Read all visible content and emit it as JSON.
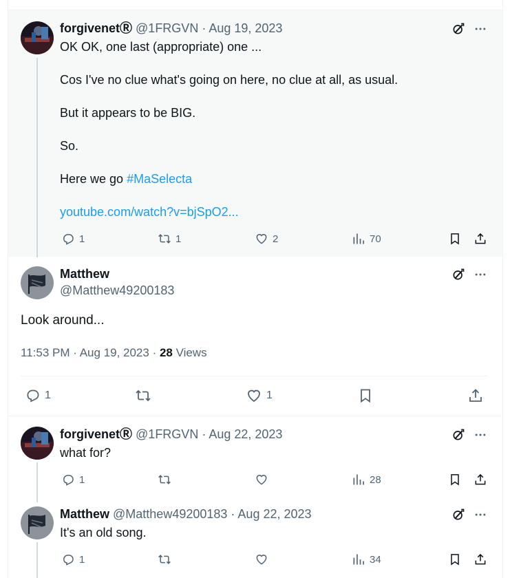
{
  "tweet1": {
    "name": "forgivenet",
    "badge": "Ⓡ",
    "handle": "@1FRGVN",
    "date": "Aug 19, 2023",
    "lines": [
      "OK OK, one last (appropriate) one ...",
      "Cos I've no clue what's going on here, no clue at all, as usual.",
      "But it appears to be BIG.",
      "So.",
      "Here we go "
    ],
    "hashtag": "#MaSelecta",
    "link": "youtube.com/watch?v=bjSpO2...",
    "replies": "1",
    "reposts": "1",
    "likes": "2",
    "views": "70"
  },
  "main": {
    "name": "Matthew",
    "handle": "@Matthew49200183",
    "text": "Look around...",
    "time": "11:53 PM",
    "date": "Aug 19, 2023",
    "views_count": "28",
    "views_label": "Views",
    "replies": "1",
    "likes": "1"
  },
  "reply1": {
    "name": "forgivenet",
    "badge": "Ⓡ",
    "handle": "@1FRGVN",
    "date": "Aug 22, 2023",
    "text": "what for?",
    "replies": "1",
    "views": "28"
  },
  "reply2": {
    "name": "Matthew",
    "handle": "@Matthew49200183",
    "date": "Aug 22, 2023",
    "text": "It's an old song.",
    "replies": "1",
    "views": "34"
  },
  "sep": " · ",
  "icons": [
    "grok-icon",
    "more-icon",
    "reply-icon",
    "repost-icon",
    "like-icon",
    "views-icon",
    "bookmark-icon",
    "share-icon"
  ],
  "colors": {
    "accent": "#1d9bf0",
    "secondary": "#536471",
    "highlight_bg": "#f7f9f9"
  }
}
